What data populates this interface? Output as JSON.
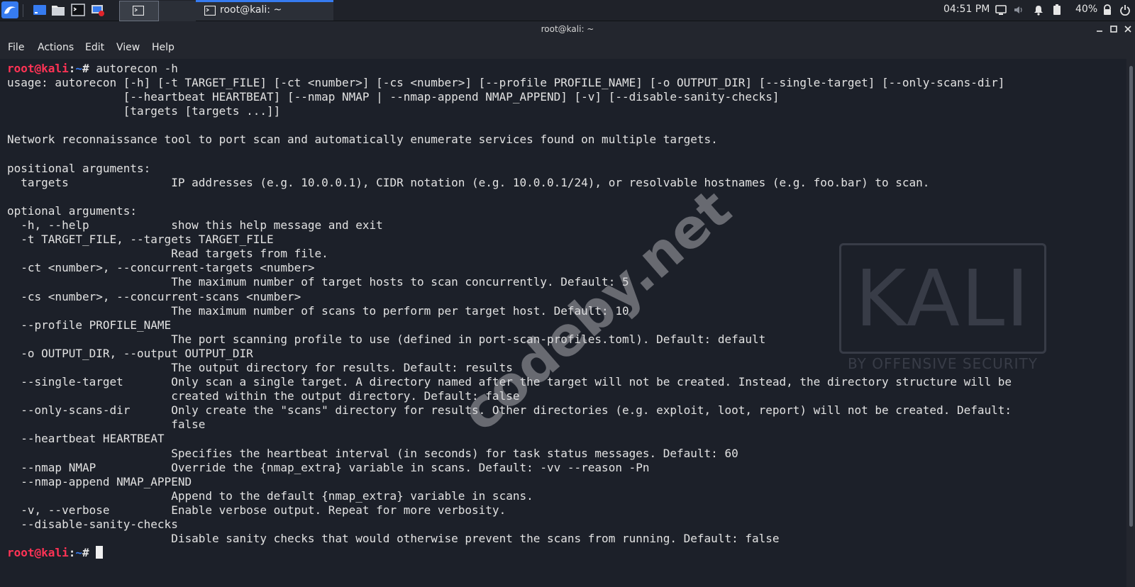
{
  "taskbar": {
    "app_menu_icon": "kali-dragon-icon",
    "launchers": [
      "show-desktop-icon",
      "file-manager-icon",
      "terminal-icon",
      "screen-recorder-icon"
    ],
    "task_title": "root@kali: ~",
    "clock": "04:51 PM",
    "battery": "40%",
    "tray_icons": [
      "display-icon",
      "volume-icon",
      "notification-bell-icon",
      "battery-icon",
      "lock-icon",
      "power-icon"
    ]
  },
  "window": {
    "title": "root@kali: ~",
    "controls": [
      "minimize-icon",
      "maximize-icon",
      "close-icon"
    ]
  },
  "menubar": {
    "items": [
      "File",
      "Actions",
      "Edit",
      "View",
      "Help"
    ]
  },
  "terminal": {
    "prompt_user": "root@kali",
    "prompt_sep": ":",
    "prompt_path": "~",
    "prompt_suffix": "# ",
    "command": "autorecon -h",
    "output": "usage: autorecon [-h] [-t TARGET_FILE] [-ct <number>] [-cs <number>] [--profile PROFILE_NAME] [-o OUTPUT_DIR] [--single-target] [--only-scans-dir]\n                 [--heartbeat HEARTBEAT] [--nmap NMAP | --nmap-append NMAP_APPEND] [-v] [--disable-sanity-checks]\n                 [targets [targets ...]]\n\nNetwork reconnaissance tool to port scan and automatically enumerate services found on multiple targets.\n\npositional arguments:\n  targets               IP addresses (e.g. 10.0.0.1), CIDR notation (e.g. 10.0.0.1/24), or resolvable hostnames (e.g. foo.bar) to scan.\n\noptional arguments:\n  -h, --help            show this help message and exit\n  -t TARGET_FILE, --targets TARGET_FILE\n                        Read targets from file.\n  -ct <number>, --concurrent-targets <number>\n                        The maximum number of target hosts to scan concurrently. Default: 5\n  -cs <number>, --concurrent-scans <number>\n                        The maximum number of scans to perform per target host. Default: 10\n  --profile PROFILE_NAME\n                        The port scanning profile to use (defined in port-scan-profiles.toml). Default: default\n  -o OUTPUT_DIR, --output OUTPUT_DIR\n                        The output directory for results. Default: results\n  --single-target       Only scan a single target. A directory named after the target will not be created. Instead, the directory structure will be\n                        created within the output directory. Default: false\n  --only-scans-dir      Only create the \"scans\" directory for results. Other directories (e.g. exploit, loot, report) will not be created. Default:\n                        false\n  --heartbeat HEARTBEAT\n                        Specifies the heartbeat interval (in seconds) for task status messages. Default: 60\n  --nmap NMAP           Override the {nmap_extra} variable in scans. Default: -vv --reason -Pn\n  --nmap-append NMAP_APPEND\n                        Append to the default {nmap_extra} variable in scans.\n  -v, --verbose         Enable verbose output. Repeat for more verbosity.\n  --disable-sanity-checks\n                        Disable sanity checks that would otherwise prevent the scans from running. Default: false"
  },
  "wallpaper": {
    "kali_text": "KALI",
    "kali_sub": "BY OFFENSIVE SECURITY"
  },
  "watermark": "codeby.net"
}
